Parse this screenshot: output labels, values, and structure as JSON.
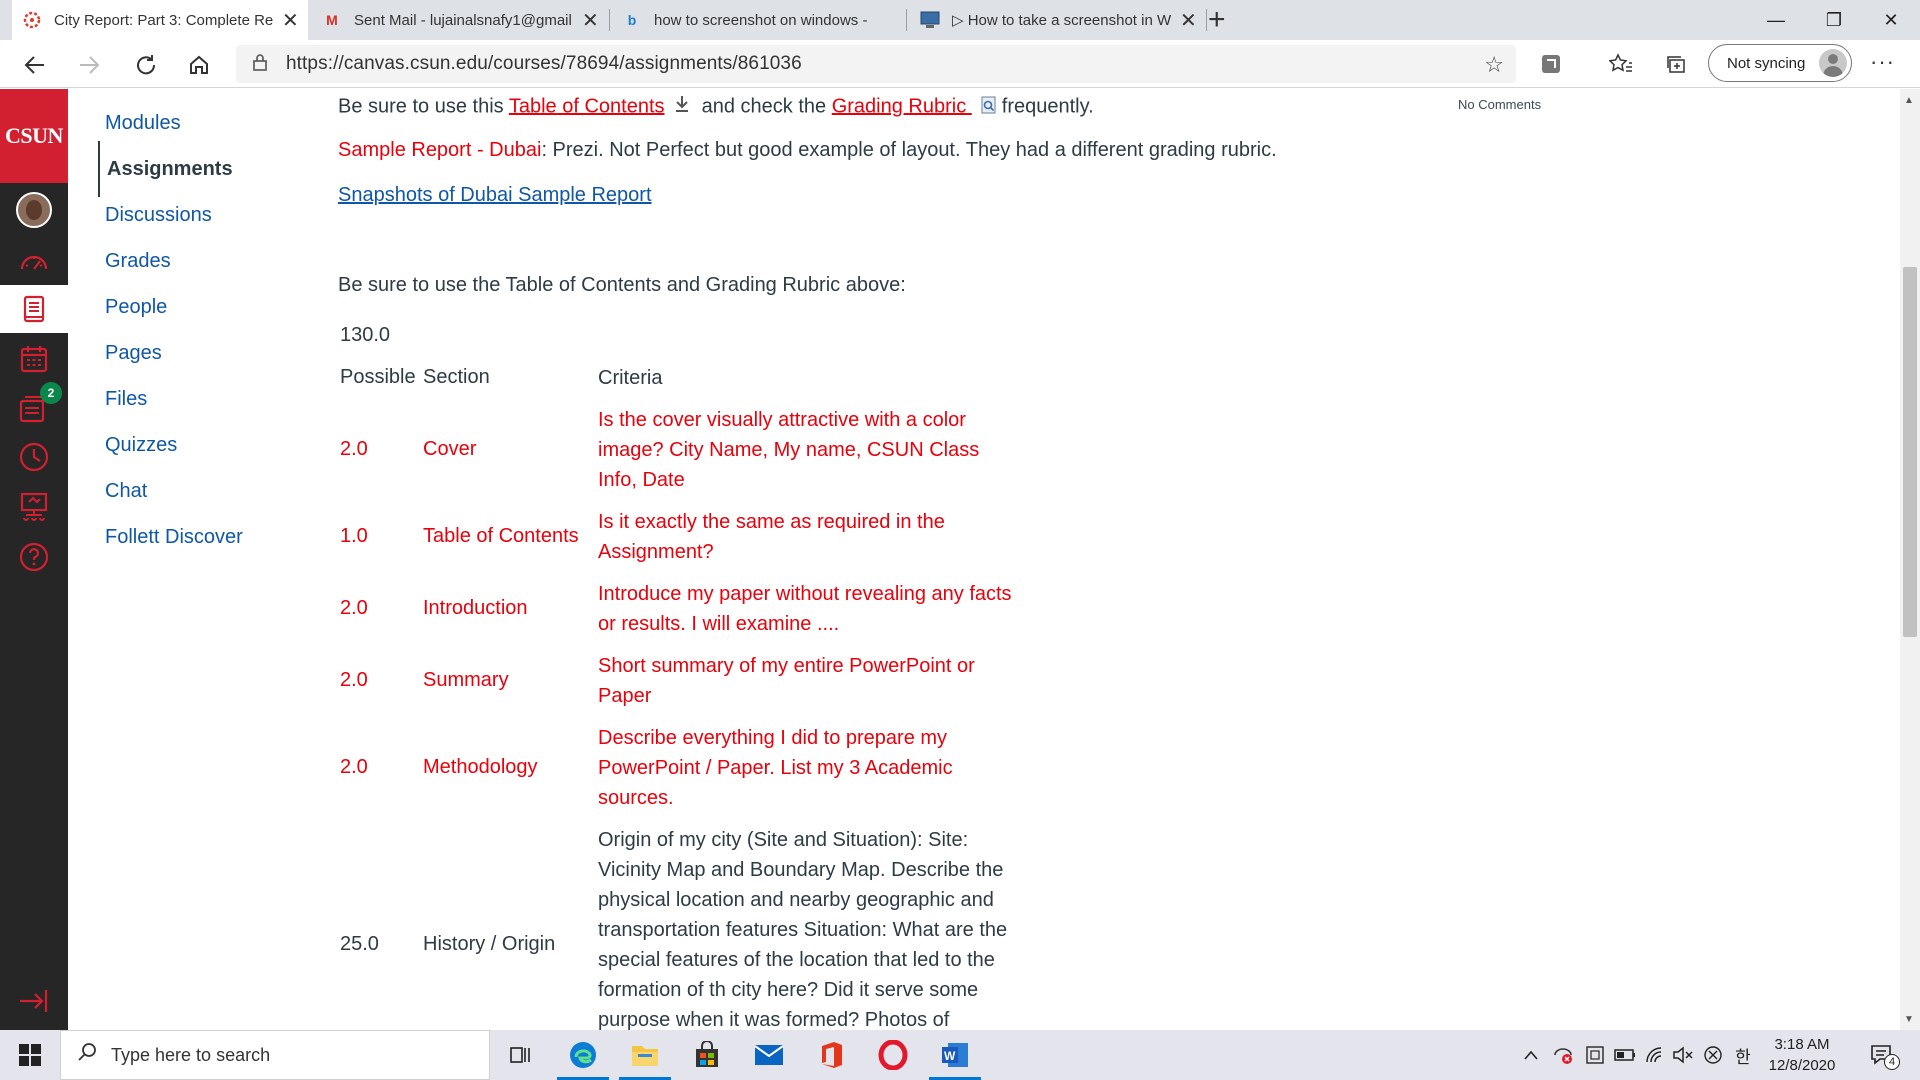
{
  "browser": {
    "tabs": [
      {
        "title": "City Report: Part 3: Complete Re",
        "icon": "canvas-icon",
        "active": true
      },
      {
        "title": "Sent Mail - lujainalsnafy1@gmail",
        "icon": "gmail-icon",
        "active": false
      },
      {
        "title": "how to screenshot on windows -",
        "icon": "bing-icon",
        "active": false
      },
      {
        "title": "▷ How to take a screenshot in W",
        "icon": "web-page-icon",
        "active": false
      }
    ],
    "url": "https://canvas.csun.edu/courses/78694/assignments/861036",
    "sync_label": "Not syncing"
  },
  "global_nav": {
    "logo": "CSUN",
    "inbox_badge": "2"
  },
  "course_nav": {
    "items": [
      "Modules",
      "Assignments",
      "Discussions",
      "Grades",
      "People",
      "Pages",
      "Files",
      "Quizzes",
      "Chat",
      "Follett Discover"
    ]
  },
  "content": {
    "line1_prefix": "Be sure to use this ",
    "toc_link": "Table of Contents",
    "line1_mid": " and check the ",
    "rubric_link": "Grading Rubric ",
    "line1_suffix": "frequently.",
    "sample_label": "Sample Report - Dubai",
    "sample_text": ":  Prezi. Not Perfect but good example of layout.  They had a different grading rubric.",
    "snapshots_link": "Snapshots of Dubai Sample Report",
    "reminder": "Be sure to use the Table of Contents and Grading Rubric above:",
    "total": "130.0",
    "headers": {
      "possible": "Possible",
      "section": "Section",
      "criteria": "Criteria"
    },
    "rows": [
      {
        "points": "2.0",
        "section": "Cover",
        "criteria": "Is the cover visually attractive with a color image? City Name, My name, CSUN Class Info, Date"
      },
      {
        "points": "1.0",
        "section": "Table of Contents",
        "criteria": "Is it exactly the same as required in the Assignment?"
      },
      {
        "points": "2.0",
        "section": "Introduction",
        "criteria": "Introduce my paper without revealing any facts or results. I will examine ...."
      },
      {
        "points": "2.0",
        "section": "Summary",
        "criteria": "Short summary of my entire PowerPoint or Paper"
      },
      {
        "points": "2.0",
        "section": "Methodology",
        "criteria": "Describe everything I did to prepare my PowerPoint / Paper.  List my 3 Academic sources."
      },
      {
        "points": "25.0",
        "section": "History / Origin",
        "criteria": "Origin of my city (Site and Situation):  Site: Vicinity Map and Boundary Map. Describe the physical location and nearby geographic and transportation  features Situation:  What are the special features of the location that led to the formation of th city here?  Did it serve some purpose when it was formed? Photos of"
      }
    ],
    "aside_label": "No Comments"
  },
  "taskbar": {
    "search_placeholder": "Type here to search",
    "time": "3:18 AM",
    "date": "12/8/2020",
    "notification_count": "4",
    "ime": "한"
  },
  "colors": {
    "accent_red": "#e8000b",
    "link_blue": "#0f57a6",
    "csun_red": "#d22030",
    "nav_dark": "#262626"
  }
}
